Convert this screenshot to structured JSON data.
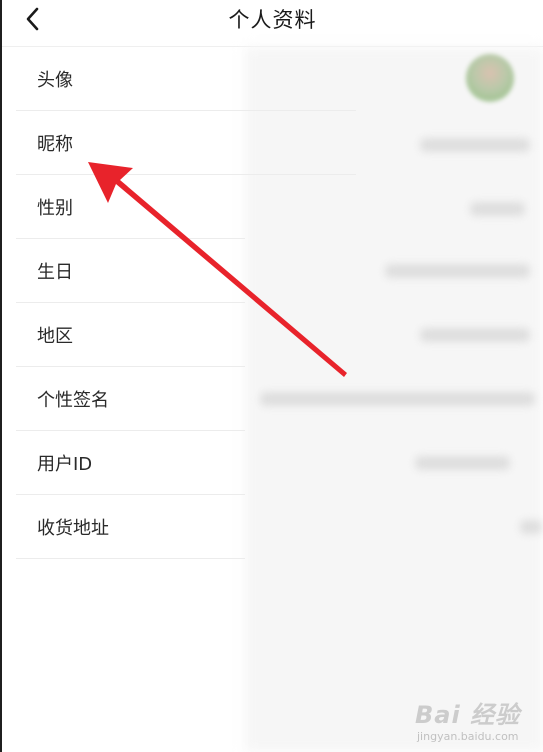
{
  "header": {
    "title": "个人资料",
    "back_icon": "chevron-left-icon"
  },
  "profile_rows": [
    {
      "label": "头像"
    },
    {
      "label": "昵称"
    },
    {
      "label": "性别"
    },
    {
      "label": "生日"
    },
    {
      "label": "地区"
    },
    {
      "label": "个性签名"
    },
    {
      "label": "用户ID"
    },
    {
      "label": "收货地址"
    }
  ],
  "annotation": {
    "arrow_color": "#e8232b"
  },
  "watermark": {
    "brand": "Bai 经验",
    "url": "jingyan.baidu.com"
  }
}
